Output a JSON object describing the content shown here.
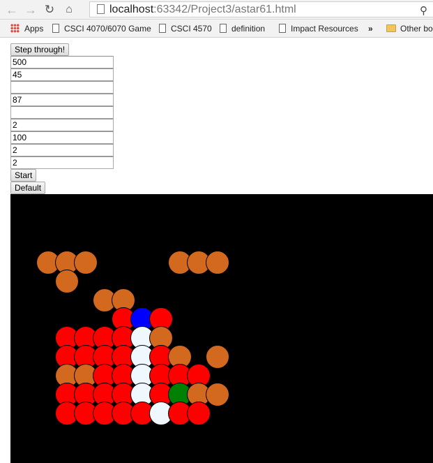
{
  "browser": {
    "url_host": "localhost",
    "url_path": ":63342/Project3/astar61.html",
    "bookmarks": [
      {
        "label": "Apps",
        "icon": "apps-grid-icon"
      },
      {
        "label": "CSCI 4070/6070 Game",
        "icon": "page-icon"
      },
      {
        "label": "CSCI 4570",
        "icon": "page-icon"
      },
      {
        "label": "definition",
        "icon": "page-icon"
      },
      {
        "label": "Impact Resources",
        "icon": "page-icon"
      },
      {
        "label": "»",
        "icon": ""
      },
      {
        "label": "Other bo",
        "icon": "folder-icon"
      }
    ]
  },
  "controls": {
    "step_label": "Step through!",
    "fields": [
      "500",
      "45",
      "",
      "87",
      "",
      "2",
      "100",
      "2",
      "2"
    ],
    "start_label": "Start",
    "default_label": "Default"
  },
  "grid": {
    "background": "#000000",
    "colors": {
      "O": "#d2691e",
      "R": "#ff0000",
      "W": "#f0f8ff",
      "B": "#0000ff",
      "G": "#008000"
    },
    "rows": [
      [
        "",
        "",
        "",
        "",
        "",
        "",
        "",
        "",
        "",
        "",
        "",
        ""
      ],
      [
        "",
        "",
        "",
        "",
        "",
        "",
        "",
        "",
        "",
        "",
        "",
        ""
      ],
      [
        "",
        "O",
        "O",
        "O",
        "",
        "",
        "",
        "",
        "O",
        "O",
        "O",
        ""
      ],
      [
        "",
        "",
        "O",
        "",
        "",
        "",
        "",
        "",
        "",
        "",
        "",
        ""
      ],
      [
        "",
        "",
        "",
        "",
        "O",
        "O",
        "",
        "",
        "",
        "",
        "",
        ""
      ],
      [
        "",
        "",
        "",
        "",
        "",
        "R",
        "B",
        "R",
        "",
        "",
        "",
        ""
      ],
      [
        "",
        "",
        "R",
        "R",
        "R",
        "R",
        "W",
        "O",
        "",
        "",
        "",
        ""
      ],
      [
        "",
        "",
        "R",
        "R",
        "R",
        "R",
        "W",
        "R",
        "O",
        "",
        "O",
        ""
      ],
      [
        "",
        "",
        "O",
        "O",
        "R",
        "R",
        "W",
        "R",
        "R",
        "R",
        "",
        ""
      ],
      [
        "",
        "",
        "R",
        "R",
        "R",
        "R",
        "W",
        "R",
        "G",
        "O",
        "O",
        ""
      ],
      [
        "",
        "",
        "R",
        "R",
        "R",
        "R",
        "R",
        "W",
        "R",
        "R",
        "",
        ""
      ]
    ]
  }
}
